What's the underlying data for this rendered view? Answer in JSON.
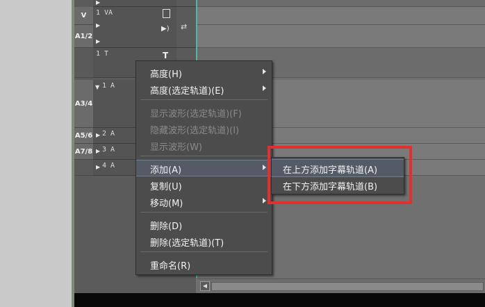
{
  "tracks": [
    {
      "patch": "V",
      "name": "1 VA"
    },
    {
      "patch": "A1/2",
      "name": ""
    },
    {
      "patch": "",
      "name": "1 T",
      "extra_icon": "T"
    },
    {
      "patch": "A3/4",
      "name": "1 A"
    },
    {
      "patch": "A5/6",
      "name": "2 A"
    },
    {
      "patch": "A7/8",
      "name": "3 A"
    },
    {
      "patch": "",
      "name": "4 A"
    }
  ],
  "context_menu": {
    "items": [
      {
        "label": "高度(H)",
        "submenu": true
      },
      {
        "label": "高度(选定轨道)(E)",
        "submenu": true
      },
      {
        "label": "显示波形(选定轨道)(F)",
        "disabled": true
      },
      {
        "label": "隐藏波形(选定轨道)(I)",
        "disabled": true
      },
      {
        "label": "显示波形(W)",
        "disabled": true
      },
      {
        "label": "添加(A)",
        "submenu": true,
        "highlighted": true
      },
      {
        "label": "复制(U)"
      },
      {
        "label": "移动(M)",
        "submenu": true
      },
      {
        "label": "删除(D)"
      },
      {
        "label": "删除(选定轨道)(T)"
      },
      {
        "label": "重命名(R)"
      }
    ]
  },
  "submenu": {
    "items": [
      {
        "label": "在上方添加字幕轨道(A)",
        "highlighted": true
      },
      {
        "label": "在下方添加字幕轨道(B)"
      }
    ]
  },
  "icons": {
    "sync": "sync-arrows-icon",
    "speaker": "speaker-icon",
    "clip": "clip-icon",
    "title": "title-T-icon"
  },
  "highlight_color": "#e0302f"
}
